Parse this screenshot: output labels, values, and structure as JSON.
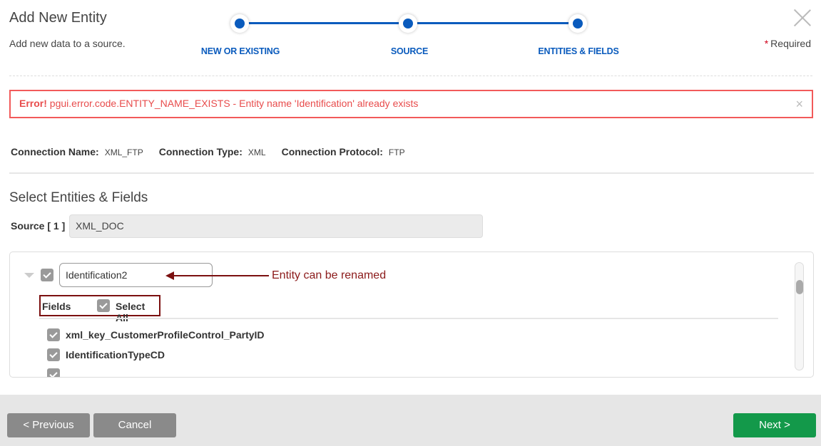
{
  "header": {
    "title": "Add New Entity",
    "subtitle": "Add new data to a source.",
    "required_star": "*",
    "required_label": "Required"
  },
  "stepper": {
    "steps": [
      {
        "label": "NEW OR EXISTING",
        "state": "complete"
      },
      {
        "label": "SOURCE",
        "state": "complete"
      },
      {
        "label": "ENTITIES & FIELDS",
        "state": "current"
      }
    ],
    "accent_color": "#0a5bbd"
  },
  "error": {
    "prefix": "Error!",
    "message": "pgui.error.code.ENTITY_NAME_EXISTS - Entity name 'Identification' already exists",
    "close_symbol": "×",
    "color": "#e84c4c"
  },
  "connection": {
    "name_label": "Connection Name:",
    "name_value": "XML_FTP",
    "type_label": "Connection Type:",
    "type_value": "XML",
    "protocol_label": "Connection Protocol:",
    "protocol_value": "FTP"
  },
  "section": {
    "title": "Select Entities & Fields",
    "source_label": "Source [ 1 ]",
    "source_value": "XML_DOC"
  },
  "entity": {
    "name_value": "Identification2",
    "checked": true,
    "annotation": "Entity can be renamed",
    "fields_label": "Fields",
    "select_all_label": "Select All",
    "select_all_checked": true,
    "fields": [
      {
        "name": "xml_key_CustomerProfileControl_PartyID",
        "checked": true
      },
      {
        "name": "IdentificationTypeCD",
        "checked": true
      }
    ]
  },
  "footer": {
    "previous_label": "< Previous",
    "cancel_label": "Cancel",
    "next_label": "Next >",
    "next_color": "#13994a"
  }
}
